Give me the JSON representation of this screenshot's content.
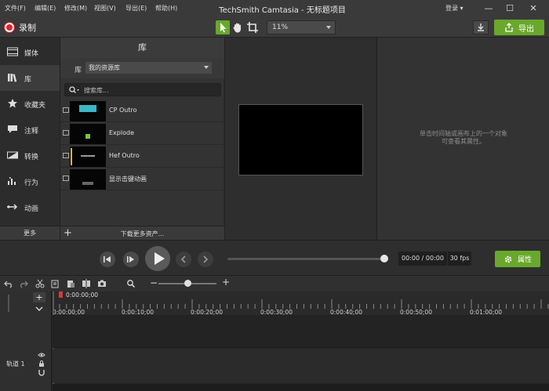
{
  "menubar": {
    "items": [
      "文件(F)",
      "编辑(E)",
      "修改(M)",
      "视图(V)",
      "导出(E)",
      "帮助(H)"
    ],
    "title": "TechSmith Camtasia - 无标题项目",
    "login": "登录 ▾",
    "window_controls": [
      "—",
      "☐",
      "✕"
    ]
  },
  "toolbar": {
    "record_label": "录制",
    "zoom_value": "11%",
    "export_label": "导出",
    "accent_color": "#69a82c",
    "record_color": "#e0242b"
  },
  "sidenav": {
    "items": [
      {
        "label": "媒体",
        "icon": "film-strip-icon"
      },
      {
        "label": "库",
        "icon": "library-books-icon"
      },
      {
        "label": "收藏夹",
        "icon": "star-icon"
      },
      {
        "label": "注释",
        "icon": "comment-icon"
      },
      {
        "label": "转换",
        "icon": "transition-icon"
      },
      {
        "label": "行为",
        "icon": "behavior-icon"
      },
      {
        "label": "动画",
        "icon": "animation-arrow-icon"
      }
    ],
    "active_index": 1,
    "more_label": "更多"
  },
  "library": {
    "header": "库",
    "label": "库",
    "selected": "我的资源库",
    "search_placeholder": "搜索库...",
    "assets": [
      {
        "name": "CP Outro"
      },
      {
        "name": "Explode"
      },
      {
        "name": "Hef Outro"
      },
      {
        "name": "显示击键动画"
      }
    ],
    "download_more": "下载更多资产..."
  },
  "properties": {
    "hint_line1": "单击时间轴或画布上的一个对象",
    "hint_line2": "可查看其属性。"
  },
  "playback": {
    "timecode": "00:00 / 00:00",
    "fps": "30 fps",
    "properties_label": "属性"
  },
  "timeline": {
    "playhead_time": "0:00:00;00",
    "ticks": [
      "0:00:00;00",
      "0:00:10;00",
      "0:00:20;00",
      "0:00:30;00",
      "0:00:40;00",
      "0:00:50;00",
      "0:01:00;00"
    ],
    "track_name": "轨道 1"
  }
}
